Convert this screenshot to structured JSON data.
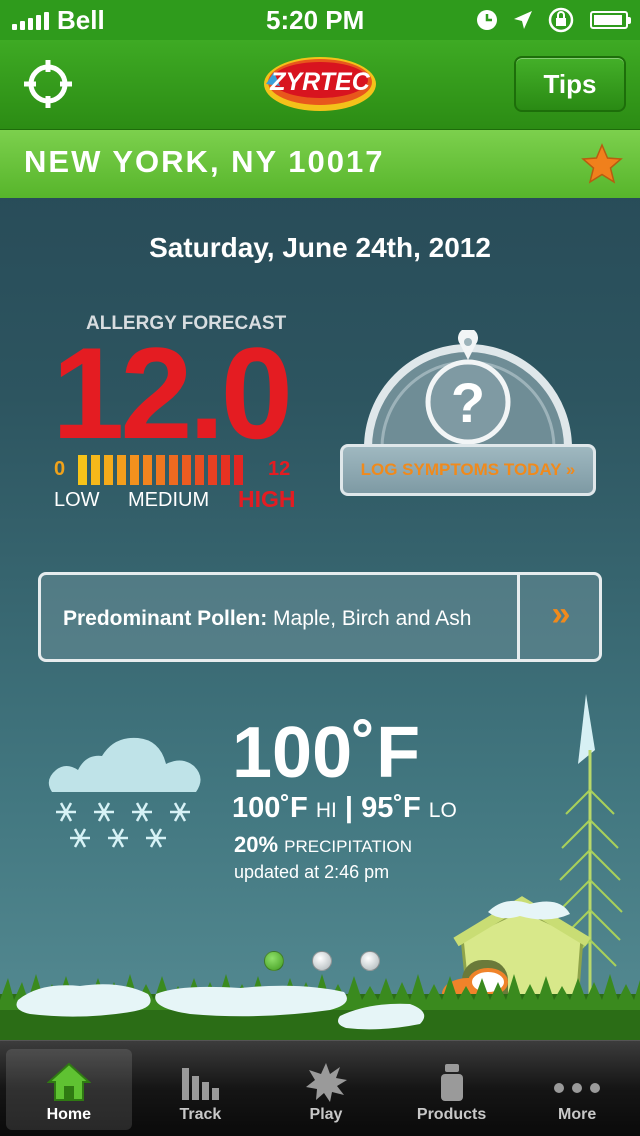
{
  "status_bar": {
    "carrier": "Bell",
    "time": "5:20 PM",
    "icons": [
      "signal-icon",
      "clock-icon",
      "location-arrow-icon",
      "orientation-lock-icon",
      "battery-icon"
    ]
  },
  "header": {
    "logo_text": "ZYRTEC",
    "tips_label": "Tips",
    "brand_color": "#2c8c14"
  },
  "location": {
    "name": "NEW YORK, NY 10017"
  },
  "date": "Saturday, June 24th, 2012",
  "forecast": {
    "label": "ALLERGY FORECAST",
    "value": "12.0",
    "scale_min": "0",
    "scale_max": "12",
    "low_label": "LOW",
    "medium_label": "MEDIUM",
    "high_label": "HIGH",
    "level_fraction": 1.0,
    "value_color": "#e41c22"
  },
  "log_symptoms": {
    "label": "LOG SYMPTOMS TODAY »",
    "icon": "question-mark-icon",
    "accent_color": "#f08a1c"
  },
  "pollen": {
    "label": "Predominant Pollen:",
    "value": "Maple, Birch and Ash",
    "arrow": "»"
  },
  "weather": {
    "temp": "100˚F",
    "hi_value": "100˚F",
    "hi_label": "HI",
    "separator": "|",
    "lo_value": "95˚F",
    "lo_label": "LO",
    "precip_value": "20%",
    "precip_label": "PRECIPITATION",
    "updated": "updated at 2:46 pm",
    "icon": "snow-cloud-icon"
  },
  "pager": {
    "count": 3,
    "active_index": 0
  },
  "tabbar": {
    "tabs": [
      {
        "label": "Home",
        "icon": "home-icon",
        "active": true
      },
      {
        "label": "Track",
        "icon": "bar-chart-icon",
        "active": false
      },
      {
        "label": "Play",
        "icon": "starburst-icon",
        "active": false
      },
      {
        "label": "Products",
        "icon": "bottle-icon",
        "active": false
      },
      {
        "label": "More",
        "icon": "more-dots-icon",
        "active": false
      }
    ]
  }
}
